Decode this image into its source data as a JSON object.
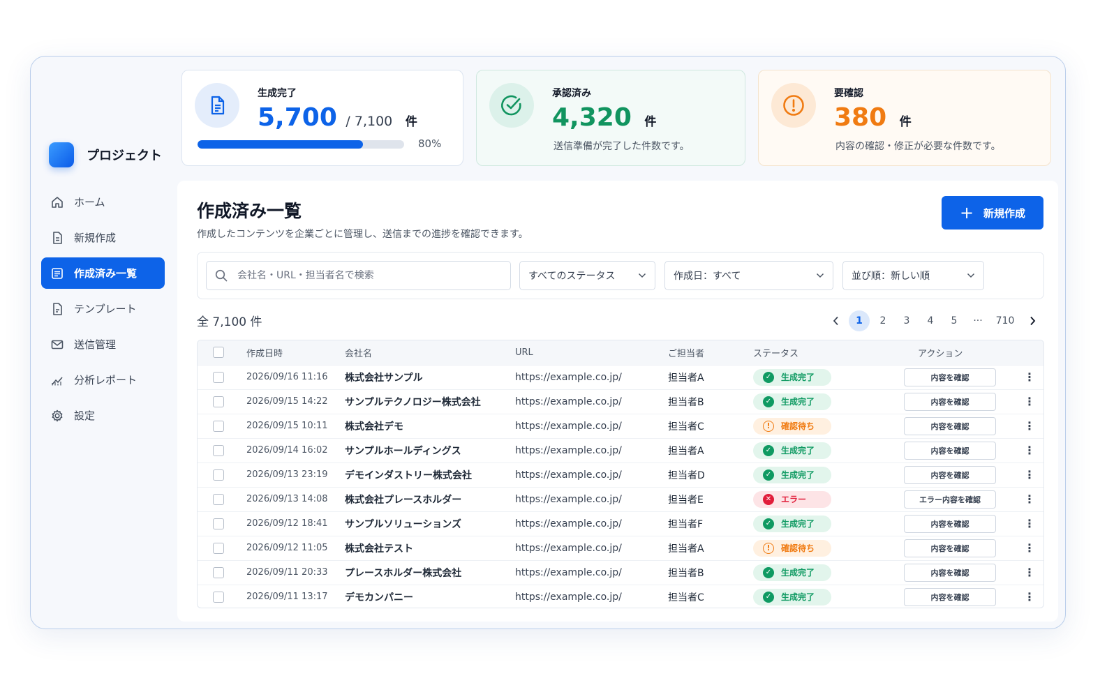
{
  "brand": {
    "name": "プロジェクト",
    "accent": "#0d63e8"
  },
  "nav": [
    {
      "label": "ホーム",
      "icon": "home-icon"
    },
    {
      "label": "新規作成",
      "icon": "file-plus-icon"
    },
    {
      "label": "作成済み一覧",
      "icon": "list-icon",
      "active": true
    },
    {
      "label": "テンプレート",
      "icon": "template-icon"
    },
    {
      "label": "送信管理",
      "icon": "mail-icon"
    },
    {
      "label": "分析レポート",
      "icon": "chart-icon"
    },
    {
      "label": "設定",
      "icon": "gear-icon"
    }
  ],
  "stats": {
    "generated": {
      "label": "生成完了",
      "value": "5,700",
      "total": "/ 7,100",
      "unit": "件",
      "progress": 0.8,
      "pct": "80%"
    },
    "approved": {
      "label": "承認済み",
      "value": "4,320",
      "unit": "件",
      "desc": "送信準備が完了した件数です。"
    },
    "review": {
      "label": "要確認",
      "value": "380",
      "unit": "件",
      "desc": "内容の確認・修正が必要な件数です。"
    }
  },
  "main": {
    "title": "作成済み一覧",
    "description": "作成したコンテンツを企業ごとに管理し、送信までの進捗を確認できます。",
    "new_button": "新規作成",
    "search_placeholder": "会社名・URL・担当者名で検索",
    "filters": {
      "status": "すべてのステータス",
      "date": "作成日：すべて",
      "sort": "並び順：新しい順"
    },
    "total": "全 7,100 件",
    "pagination": [
      "1",
      "2",
      "3",
      "4",
      "5",
      "···",
      "710"
    ],
    "current_page": "1"
  },
  "table": {
    "columns": [
      "作成日時",
      "会社名",
      "URL",
      "ご担当者",
      "ステータス",
      "アクション"
    ],
    "rows": [
      {
        "date": "2026/09/16 11:16",
        "company": "株式会社サンプル",
        "url": "https://example.co.jp/",
        "person": "担当者A",
        "status": "生成完了",
        "status_type": "ok",
        "action": "内容を確認"
      },
      {
        "date": "2026/09/15 14:22",
        "company": "サンプルテクノロジー株式会社",
        "url": "https://example.co.jp/",
        "person": "担当者B",
        "status": "生成完了",
        "status_type": "ok",
        "action": "内容を確認"
      },
      {
        "date": "2026/09/15 10:11",
        "company": "株式会社デモ",
        "url": "https://example.co.jp/",
        "person": "担当者C",
        "status": "確認待ち",
        "status_type": "wait",
        "action": "内容を確認"
      },
      {
        "date": "2026/09/14 16:02",
        "company": "サンプルホールディングス",
        "url": "https://example.co.jp/",
        "person": "担当者A",
        "status": "生成完了",
        "status_type": "ok",
        "action": "内容を確認"
      },
      {
        "date": "2026/09/13 23:19",
        "company": "デモインダストリー株式会社",
        "url": "https://example.co.jp/",
        "person": "担当者D",
        "status": "生成完了",
        "status_type": "ok",
        "action": "内容を確認"
      },
      {
        "date": "2026/09/13 14:08",
        "company": "株式会社プレースホルダー",
        "url": "https://example.co.jp/",
        "person": "担当者E",
        "status": "エラー",
        "status_type": "err",
        "action": "エラー内容を確認"
      },
      {
        "date": "2026/09/12 18:41",
        "company": "サンプルソリューションズ",
        "url": "https://example.co.jp/",
        "person": "担当者F",
        "status": "生成完了",
        "status_type": "ok",
        "action": "内容を確認"
      },
      {
        "date": "2026/09/12 11:05",
        "company": "株式会社テスト",
        "url": "https://example.co.jp/",
        "person": "担当者A",
        "status": "確認待ち",
        "status_type": "wait",
        "action": "内容を確認"
      },
      {
        "date": "2026/09/11 20:33",
        "company": "プレースホルダー株式会社",
        "url": "https://example.co.jp/",
        "person": "担当者B",
        "status": "生成完了",
        "status_type": "ok",
        "action": "内容を確認"
      },
      {
        "date": "2026/09/11 13:17",
        "company": "デモカンパニー",
        "url": "https://example.co.jp/",
        "person": "担当者C",
        "status": "生成完了",
        "status_type": "ok",
        "action": "内容を確認"
      }
    ]
  }
}
